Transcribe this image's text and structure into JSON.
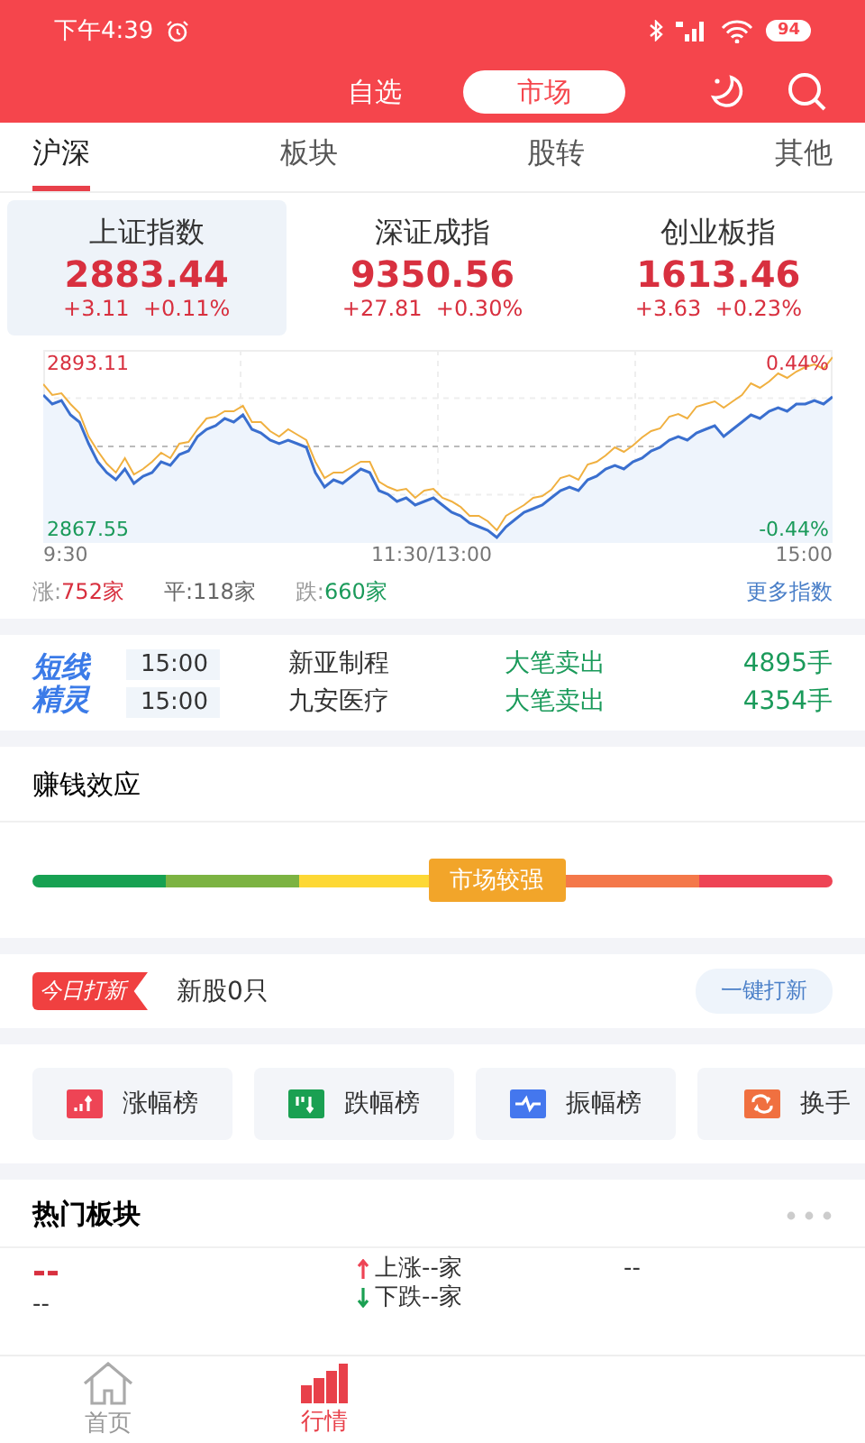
{
  "status_bar": {
    "time": "下午4:39",
    "battery": "94"
  },
  "header": {
    "tabs": [
      {
        "label": "自选",
        "selected": false
      },
      {
        "label": "市场",
        "selected": true
      }
    ]
  },
  "market_tabs": [
    {
      "label": "沪深",
      "selected": true
    },
    {
      "label": "板块",
      "selected": false
    },
    {
      "label": "股转",
      "selected": false
    },
    {
      "label": "其他",
      "selected": false
    }
  ],
  "indices": [
    {
      "name": "上证指数",
      "value": "2883.44",
      "change": "+3.11",
      "percent": "+0.11%",
      "selected": true
    },
    {
      "name": "深证成指",
      "value": "9350.56",
      "change": "+27.81",
      "percent": "+0.30%",
      "selected": false
    },
    {
      "name": "创业板指",
      "value": "1613.46",
      "change": "+3.63",
      "percent": "+0.23%",
      "selected": false
    }
  ],
  "chart": {
    "high": "2893.11",
    "low": "2867.55",
    "high_pct": "0.44%",
    "low_pct": "-0.44%",
    "times": [
      "9:30",
      "11:30/13:00",
      "15:00"
    ]
  },
  "breadth": {
    "up_label": "涨:",
    "up": "752家",
    "flat_label": "平:",
    "flat": "118家",
    "down_label": "跌:",
    "down": "660家",
    "more": "更多指数"
  },
  "spirit": {
    "logo": "短线精灵",
    "rows": [
      {
        "time": "15:00",
        "stock": "新亚制程",
        "event": "大笔卖出",
        "volume": "4895手"
      },
      {
        "time": "15:00",
        "stock": "九安医疗",
        "event": "大笔卖出",
        "volume": "4354手"
      }
    ]
  },
  "money_effect": {
    "title": "赚钱效应",
    "badge": "市场较强"
  },
  "ipo": {
    "tag": "今日打新",
    "text": "新股0只",
    "button": "一键打新"
  },
  "rankings": [
    {
      "label": "涨幅榜",
      "kind": "rise",
      "color": "#ee4455"
    },
    {
      "label": "跌幅榜",
      "kind": "fall",
      "color": "#1aa052"
    },
    {
      "label": "振幅榜",
      "kind": "swing",
      "color": "#4477ee"
    },
    {
      "label": "换手",
      "kind": "turnover",
      "color": "#f07040"
    }
  ],
  "hot_sectors": {
    "title": "热门板块",
    "name": "--",
    "sub": "--",
    "up": "上涨--家",
    "down": "下跌--家",
    "leader": "--"
  },
  "bottom_nav": [
    {
      "label": "首页",
      "kind": "home",
      "selected": false
    },
    {
      "label": "行情",
      "kind": "market",
      "selected": true
    }
  ]
}
